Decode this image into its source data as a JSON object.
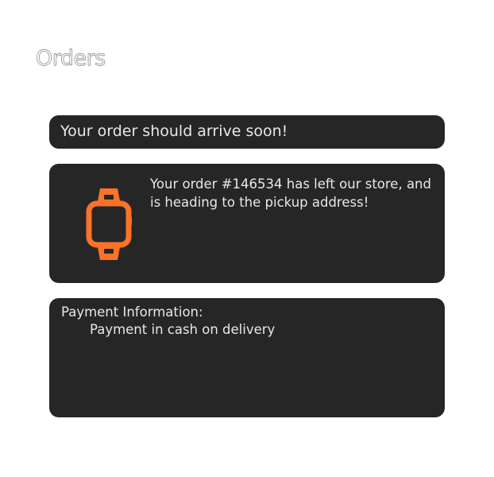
{
  "page": {
    "title": "Orders"
  },
  "status_card": {
    "message": "Your order should arrive soon!"
  },
  "shipping_card": {
    "icon": "smartwatch-icon",
    "icon_color": "#fb7328",
    "message": "Your order #146534 has left our store, and is heading to the pickup address!"
  },
  "payment_card": {
    "heading": "Payment Information:",
    "method": "Payment in cash on delivery"
  },
  "colors": {
    "card_background": "#272627",
    "card_text": "#e8e8e8",
    "accent": "#fb7328"
  }
}
